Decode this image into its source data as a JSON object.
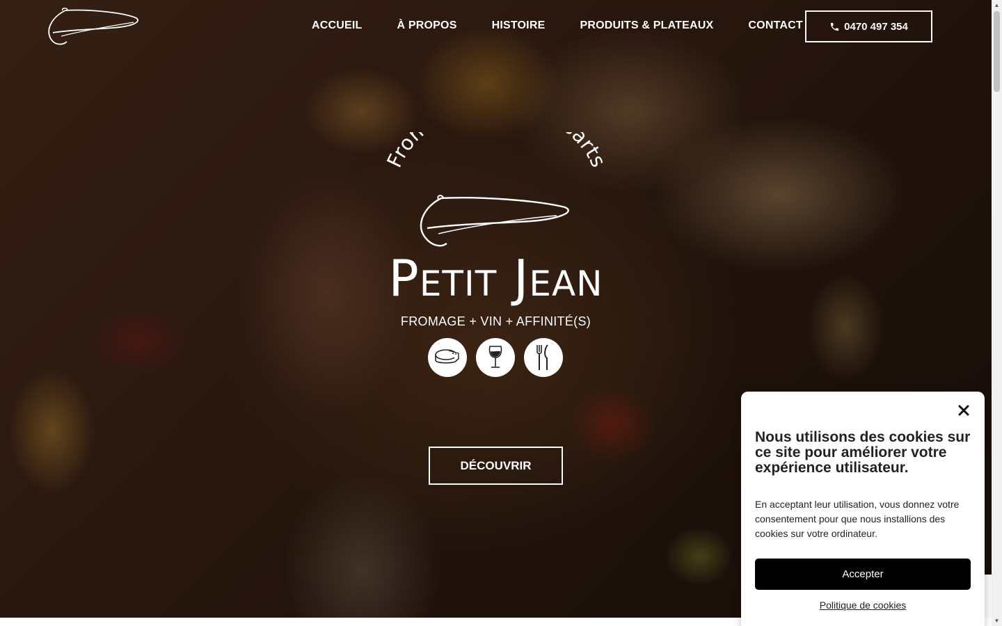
{
  "nav": {
    "items": [
      {
        "label": "ACCUEIL"
      },
      {
        "label": "À PROPOS"
      },
      {
        "label": "HISTOIRE"
      },
      {
        "label": "PRODUITS & PLATEAUX"
      },
      {
        "label": "CONTACT"
      }
    ],
    "phone": "0470 497 354"
  },
  "brand": {
    "arc": "Fromagerie des Essarts",
    "name": "Petit Jean",
    "tagline": "FROMAGE + VIN + AFFINITÉ(S)",
    "icons": [
      "cheese-icon",
      "wine-glass-icon",
      "cutlery-icon"
    ]
  },
  "hero": {
    "cta": "DÉCOUVRIR"
  },
  "cookie": {
    "title": "Nous utilisons des cookies sur ce site pour améliorer votre expérience utilisateur.",
    "text": "En acceptant leur utilisation, vous donnez votre consentement pour que nous installions des cookies sur votre ordinateur.",
    "accept": "Accepter",
    "policy": "Politique de cookies"
  },
  "colors": {
    "text_on_hero": "#ffffff",
    "cookie_button": "#000000"
  }
}
